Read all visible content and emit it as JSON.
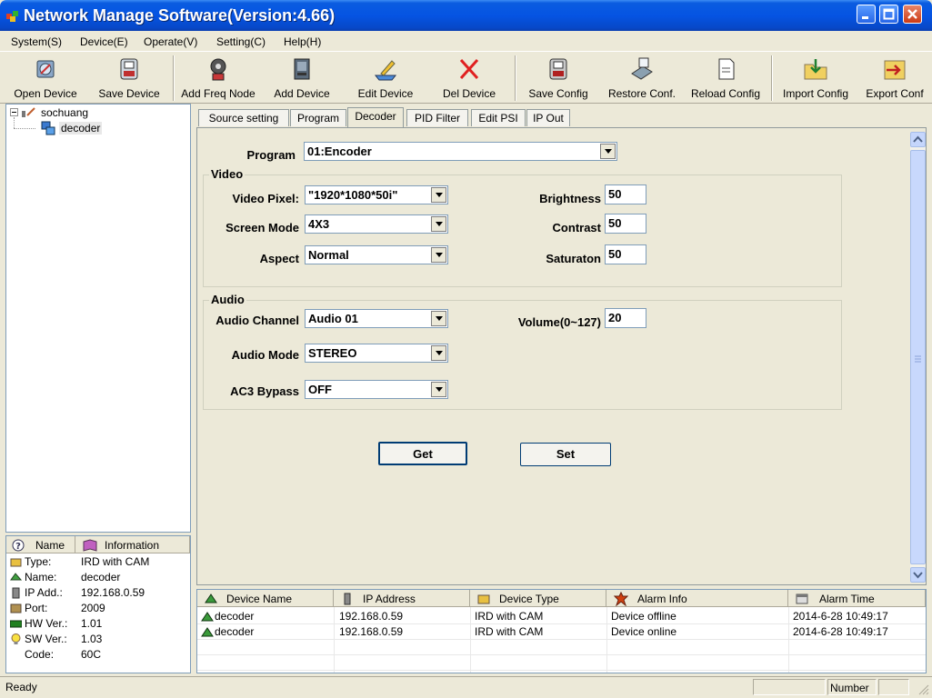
{
  "window": {
    "title": "Network Manage Software(Version:4.66)"
  },
  "menu": [
    "System(S)",
    "Device(E)",
    "Operate(V)",
    "Setting(C)",
    "Help(H)"
  ],
  "toolbar": [
    {
      "label": "Open Device",
      "icon": "open-device-icon"
    },
    {
      "label": "Save Device",
      "icon": "save-device-icon"
    },
    {
      "label": "Add Freq Node",
      "icon": "add-freq-node-icon"
    },
    {
      "label": "Add Device",
      "icon": "add-device-icon"
    },
    {
      "label": "Edit Device",
      "icon": "edit-device-icon"
    },
    {
      "label": "Del Device",
      "icon": "delete-icon"
    },
    {
      "label": "Save Config",
      "icon": "save-config-icon"
    },
    {
      "label": "Restore Conf.",
      "icon": "restore-config-icon"
    },
    {
      "label": "Reload Config",
      "icon": "reload-config-icon"
    },
    {
      "label": "Import Config",
      "icon": "import-config-icon"
    },
    {
      "label": "Export Conf",
      "icon": "export-config-icon"
    }
  ],
  "tree": {
    "root": "sochuang",
    "child": "decoder"
  },
  "info": {
    "col_name": "Name",
    "col_info": "Information",
    "rows": [
      {
        "key": "Type:",
        "value": "IRD with CAM"
      },
      {
        "key": "Name:",
        "value": "decoder"
      },
      {
        "key": "IP Add.:",
        "value": "192.168.0.59"
      },
      {
        "key": "Port:",
        "value": "2009"
      },
      {
        "key": "HW Ver.:",
        "value": "1.01"
      },
      {
        "key": "SW Ver.:",
        "value": "1.03"
      },
      {
        "key": "Code:",
        "value": "60C"
      }
    ]
  },
  "tabs": [
    "Source setting",
    "Program",
    "Decoder",
    "PID Filter",
    "Edit PSI",
    "IP Out"
  ],
  "active_tab": "Decoder",
  "form": {
    "program_label": "Program",
    "program_value": "01:Encoder",
    "video_group": "Video",
    "video_pixel_label": "Video Pixel:",
    "video_pixel_value": "\"1920*1080*50i\"",
    "screen_mode_label": "Screen Mode",
    "screen_mode_value": "4X3",
    "aspect_label": "Aspect",
    "aspect_value": "Normal",
    "brightness_label": "Brightness",
    "brightness_value": "50",
    "contrast_label": "Contrast",
    "contrast_value": "50",
    "saturation_label": "Saturaton",
    "saturation_value": "50",
    "audio_group": "Audio",
    "audio_channel_label": "Audio Channel",
    "audio_channel_value": "Audio 01",
    "audio_mode_label": "Audio Mode",
    "audio_mode_value": "STEREO",
    "ac3_label": "AC3 Bypass",
    "ac3_value": "OFF",
    "volume_label": "Volume(0~127)",
    "volume_value": "20",
    "get_label": "Get",
    "set_label": "Set"
  },
  "alarm": {
    "columns": [
      "Device Name",
      "IP Address",
      "Device Type",
      "Alarm Info",
      "Alarm Time"
    ],
    "rows": [
      {
        "name": "decoder",
        "ip": "192.168.0.59",
        "type": "IRD with CAM",
        "info": "Device offline",
        "time": "2014-6-28 10:49:17"
      },
      {
        "name": "decoder",
        "ip": "192.168.0.59",
        "type": "IRD with CAM",
        "info": "Device online",
        "time": "2014-6-28 10:49:17"
      }
    ]
  },
  "status": {
    "text": "Ready",
    "num": "Number"
  }
}
